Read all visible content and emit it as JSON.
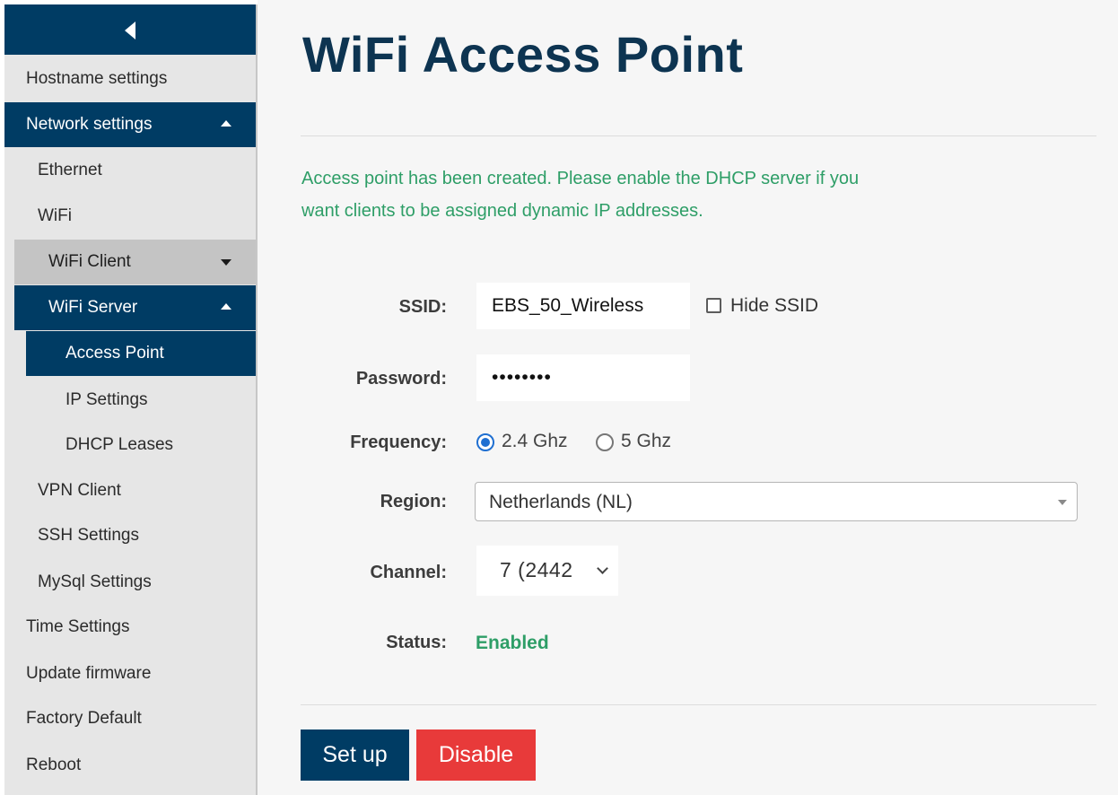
{
  "sidebar": {
    "items": [
      {
        "label": "Hostname settings"
      },
      {
        "label": "Network settings"
      },
      {
        "label": "Ethernet"
      },
      {
        "label": "WiFi"
      },
      {
        "label": "WiFi Client"
      },
      {
        "label": "WiFi Server"
      },
      {
        "label": "Access Point"
      },
      {
        "label": "IP Settings"
      },
      {
        "label": "DHCP Leases"
      },
      {
        "label": "VPN Client"
      },
      {
        "label": "SSH Settings"
      },
      {
        "label": "MySql Settings"
      },
      {
        "label": "Time Settings"
      },
      {
        "label": "Update firmware"
      },
      {
        "label": "Factory Default"
      },
      {
        "label": "Reboot"
      }
    ],
    "active_item": "Access Point",
    "active_color": "#003c64"
  },
  "main": {
    "title": "WiFi Access Point",
    "message": "Access point has been created. Please enable the DHCP server if you want clients to be assigned dynamic IP addresses.",
    "form": {
      "ssid_label": "SSID:",
      "ssid_value": "EBS_50_Wireless",
      "hide_ssid_label": "Hide SSID",
      "hide_ssid_checked": false,
      "password_label": "Password:",
      "password_value": "••••••••",
      "frequency_label": "Frequency:",
      "frequency_options": [
        "2.4 Ghz",
        "5 Ghz"
      ],
      "frequency_selected": "2.4 Ghz",
      "region_label": "Region:",
      "region_value": "Netherlands (NL)",
      "channel_label": "Channel:",
      "channel_value": "7 (2442",
      "status_label": "Status:",
      "status_value": "Enabled"
    },
    "buttons": {
      "setup_label": "Set up",
      "disable_label": "Disable"
    }
  },
  "colors": {
    "brand_dark": "#003c64",
    "success": "#2e9e67",
    "danger": "#e83a3a"
  }
}
